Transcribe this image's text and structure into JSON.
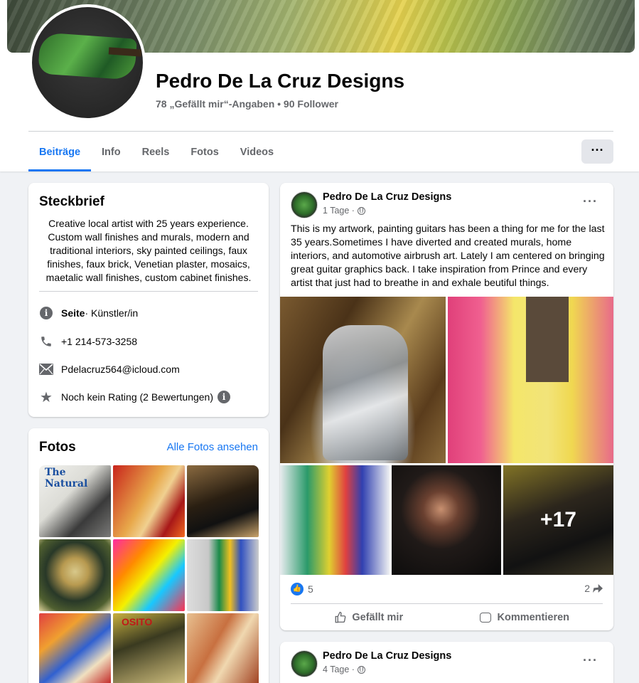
{
  "page": {
    "name": "Pedro De La Cruz Designs",
    "meta": "78 „Gefällt mir“-Angaben • 90 Follower",
    "more_label": "···"
  },
  "tabs": [
    {
      "label": "Beiträge",
      "active": true
    },
    {
      "label": "Info"
    },
    {
      "label": "Reels"
    },
    {
      "label": "Fotos"
    },
    {
      "label": "Videos"
    }
  ],
  "about": {
    "title": "Steckbrief",
    "bio": "Creative local artist with 25 years experience. Custom wall finishes and murals, modern and traditional interiors, sky painted ceilings, faux finishes, faux brick, Venetian plaster, mosaics, maetalic wall finishes, custom cabinet finishes.",
    "category_prefix": "Seite",
    "category": " · Künstler/in",
    "phone": "+1 214-573-3258",
    "email": "Pdelacruz564@icloud.com",
    "rating": "Noch kein Rating (2 Bewertungen)"
  },
  "photos": {
    "title": "Fotos",
    "see_all": "Alle Fotos ansehen"
  },
  "post": {
    "author": "Pedro De La Cruz Designs",
    "time": "1 Tage ·",
    "text": "This is my artwork, painting guitars has been a thing for me for the last 35 years.Sometimes I have diverted and created murals, home interiors, and automotive airbrush art. Lately I am centered on bringing great guitar graphics back. I take inspiration from Prince and every artist that just had to breathe in and exhale beutiful things.",
    "more_photos": "+17",
    "likes": "5",
    "shares": "2",
    "like_label": "Gefällt mir",
    "comment_label": "Kommentieren"
  },
  "post2": {
    "author": "Pedro De La Cruz Designs",
    "time": "4 Tage ·"
  },
  "colors": {
    "accent": "#1877f2",
    "secondary_text": "#65676b",
    "background": "#f0f2f5"
  }
}
